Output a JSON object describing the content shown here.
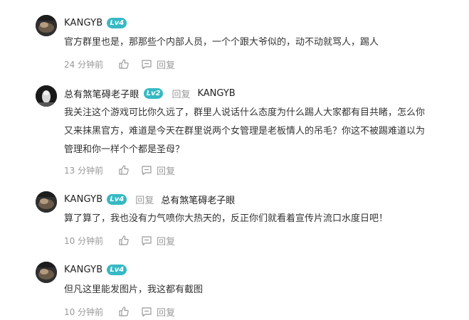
{
  "comments": [
    {
      "user": "KANGYB",
      "level": "Lv4",
      "lines": [
        "官方群里也是，那那些个内部人员，一个个跟大爷似的，动不动就骂人，踢人"
      ],
      "time": "24 分钟前",
      "reply_label": "回复"
    },
    {
      "user": "总有煞笔碍老子眼",
      "level": "Lv2",
      "reply_word": "回复",
      "reply_to": "KANGYB",
      "lines": [
        "我关注这个游戏可比你久远了，群里人说话什么态度为什么踢人大家都有目共睹，怎么你",
        "又来抹黑官方，难道是今天在群里说两个女管理是老板情人的吊毛？你这不被踢难道以为",
        "管理和你一样个个都是圣母？"
      ],
      "time": "13 分钟前",
      "reply_label": "回复"
    },
    {
      "user": "KANGYB",
      "level": "Lv4",
      "reply_word": "回复",
      "reply_to": "总有煞笔碍老子眼",
      "lines": [
        "算了算了，我也没有力气喷你大热天的，反正你们就看着宣传片流口水度日吧！"
      ],
      "time": "10 分钟前",
      "reply_label": "回复"
    },
    {
      "user": "KANGYB",
      "level": "Lv4",
      "lines": [
        "但凡这里能发图片，我这都有截图"
      ],
      "time": "10 分钟前",
      "reply_label": "回复"
    }
  ],
  "colors": {
    "level_badge": "#36b9c4",
    "muted_text": "#999999",
    "body_text": "#333333"
  },
  "icons": {
    "like": "thumbs-up-icon",
    "reply": "message-icon"
  }
}
